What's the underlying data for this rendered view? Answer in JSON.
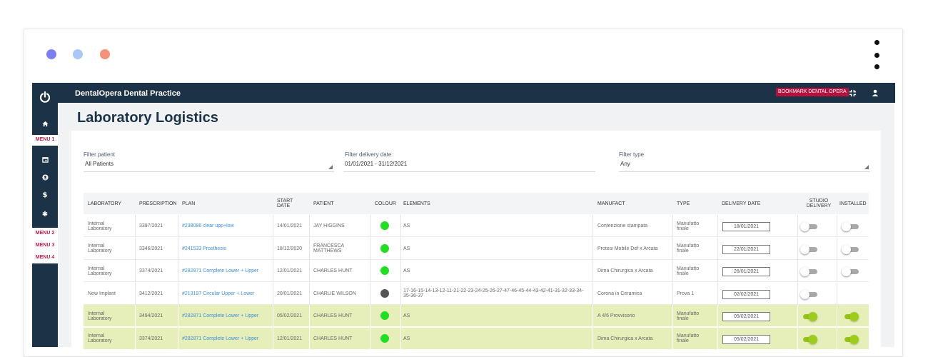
{
  "window": {
    "dots": [
      {
        "name": "dot-blue",
        "color": "#7b7ff0"
      },
      {
        "name": "dot-lightblue",
        "color": "#a9c8f6"
      },
      {
        "name": "dot-orange",
        "color": "#f6917a"
      }
    ]
  },
  "app": {
    "practice_name": "DentalOpera Dental Practice",
    "bookmark_label": "BOOKMARK DENTAL OPERA"
  },
  "sidebar": {
    "menu1": "MENU 1",
    "menu2": "MENU 2",
    "menu3": "MENU 3",
    "menu4": "MENU 4"
  },
  "page": {
    "title": "Laboratory Logistics"
  },
  "filters": {
    "patient_label": "Filter patient",
    "patient_value": "All Patients",
    "date_label": "Filter delivery date",
    "date_value": "01/01/2021 - 31/12/2021",
    "type_label": "Filter type",
    "type_value": "Any"
  },
  "table": {
    "headers": {
      "laboratory": "LABORATORY",
      "prescription": "PRESCRIPTION",
      "plan": "PLAN",
      "start_date_1": "START",
      "start_date_2": "DATE",
      "patient": "PATIENT",
      "colour": "COLOUR",
      "elements": "ELEMENTS",
      "manufact": "MANUFACT",
      "type": "TYPE",
      "delivery_date": "DELIVERY DATE",
      "studio_delivery_1": "STUDIO",
      "studio_delivery_2": "DELIVERY",
      "installed": "INSTALLED"
    },
    "rows": [
      {
        "lab1": "Internal",
        "lab2": "Laboratory",
        "prescription": "3397/2021",
        "plan": "#238086 clear upp+low",
        "start": "14/01/2021",
        "patient1": "JAY HIGGINS",
        "patient2": "",
        "colour": "#22dd22",
        "elements": "AS",
        "elements2": "",
        "manufact": "Contenzione stampata",
        "type1": "Manufatto",
        "type2": "finale",
        "delivery": "18/01/2021",
        "studio": false,
        "installed": false
      },
      {
        "lab1": "Internal",
        "lab2": "Laboratory",
        "prescription": "3346/2021",
        "plan": "#241533 Prosthesis",
        "start": "18/12/2020",
        "patient1": "FRANCESCA",
        "patient2": "MATTHEWS",
        "colour": "#22dd22",
        "elements": "AS",
        "elements2": "",
        "manufact": "Protesi Mobile Def x Arcata",
        "type1": "Manufatto",
        "type2": "finale",
        "delivery": "22/01/2021",
        "studio": false,
        "installed": false
      },
      {
        "lab1": "Internal",
        "lab2": "Laboratory",
        "prescription": "3374/2021",
        "plan": "#282871 Complete Lower + Upper",
        "start": "12/01/2021",
        "patient1": "CHARLES HUNT",
        "patient2": "",
        "colour": "#22dd22",
        "elements": "AS",
        "elements2": "",
        "manufact": "Dima Chirurgica x Arcata",
        "type1": "Manufatto",
        "type2": "finale",
        "delivery": "26/01/2021",
        "studio": false,
        "installed": false
      },
      {
        "lab1": "New Implant",
        "lab2": "",
        "prescription": "3412/2021",
        "plan": "#213197 Circular Upper + Lower",
        "start": "20/01/2021",
        "patient1": "CHARLIE WILSON",
        "patient2": "",
        "colour": "#555555",
        "elements": "17-16-15-14-13-12-11-21-22-23-24-25-26-27-47-46-45-44-43-42-41-31-32-33-34-",
        "elements2": "35-36-37",
        "manufact": "Corona in Ceramica",
        "type1": "Prova 1",
        "type2": "",
        "delivery": "02/02/2021",
        "studio": false,
        "installed": null
      },
      {
        "lab1": "Internal",
        "lab2": "Laboratory",
        "prescription": "3494/2021",
        "plan": "#282871 Complete Lower + Upper",
        "start": "05/02/2021",
        "patient1": "CHARLES HUNT",
        "patient2": "",
        "colour": "#22dd22",
        "elements": "AS",
        "elements2": "",
        "manufact": "A 4/6 Provvisorio",
        "type1": "Manufatto",
        "type2": "finale",
        "delivery": "05/02/2021",
        "studio": true,
        "installed": true
      },
      {
        "lab1": "Internal",
        "lab2": "Laboratory",
        "prescription": "3374/2021",
        "plan": "#282871 Complete Lower + Upper",
        "start": "12/01/2021",
        "patient1": "CHARLES HUNT",
        "patient2": "",
        "colour": "#22dd22",
        "elements": "AS",
        "elements2": "",
        "manufact": "Dima Chirurgica x Arcata",
        "type1": "Manufatto",
        "type2": "finale",
        "delivery": "05/02/2021",
        "studio": true,
        "installed": true
      }
    ]
  },
  "icons": {
    "power": "power-icon",
    "home": "home-icon",
    "calendar": "calendar-icon",
    "user_circle": "user-circle-icon",
    "dollar": "dollar-icon",
    "gear": "gear-icon",
    "shrink": "shrink-icon",
    "user": "user-icon",
    "kebab": "kebab-menu-icon"
  },
  "colors": {
    "navy": "#1c3347",
    "accent_red": "#b3123f",
    "link_blue": "#3a8fd8",
    "highlight_row": "#e6efba",
    "toggle_on": "#99c21a"
  }
}
